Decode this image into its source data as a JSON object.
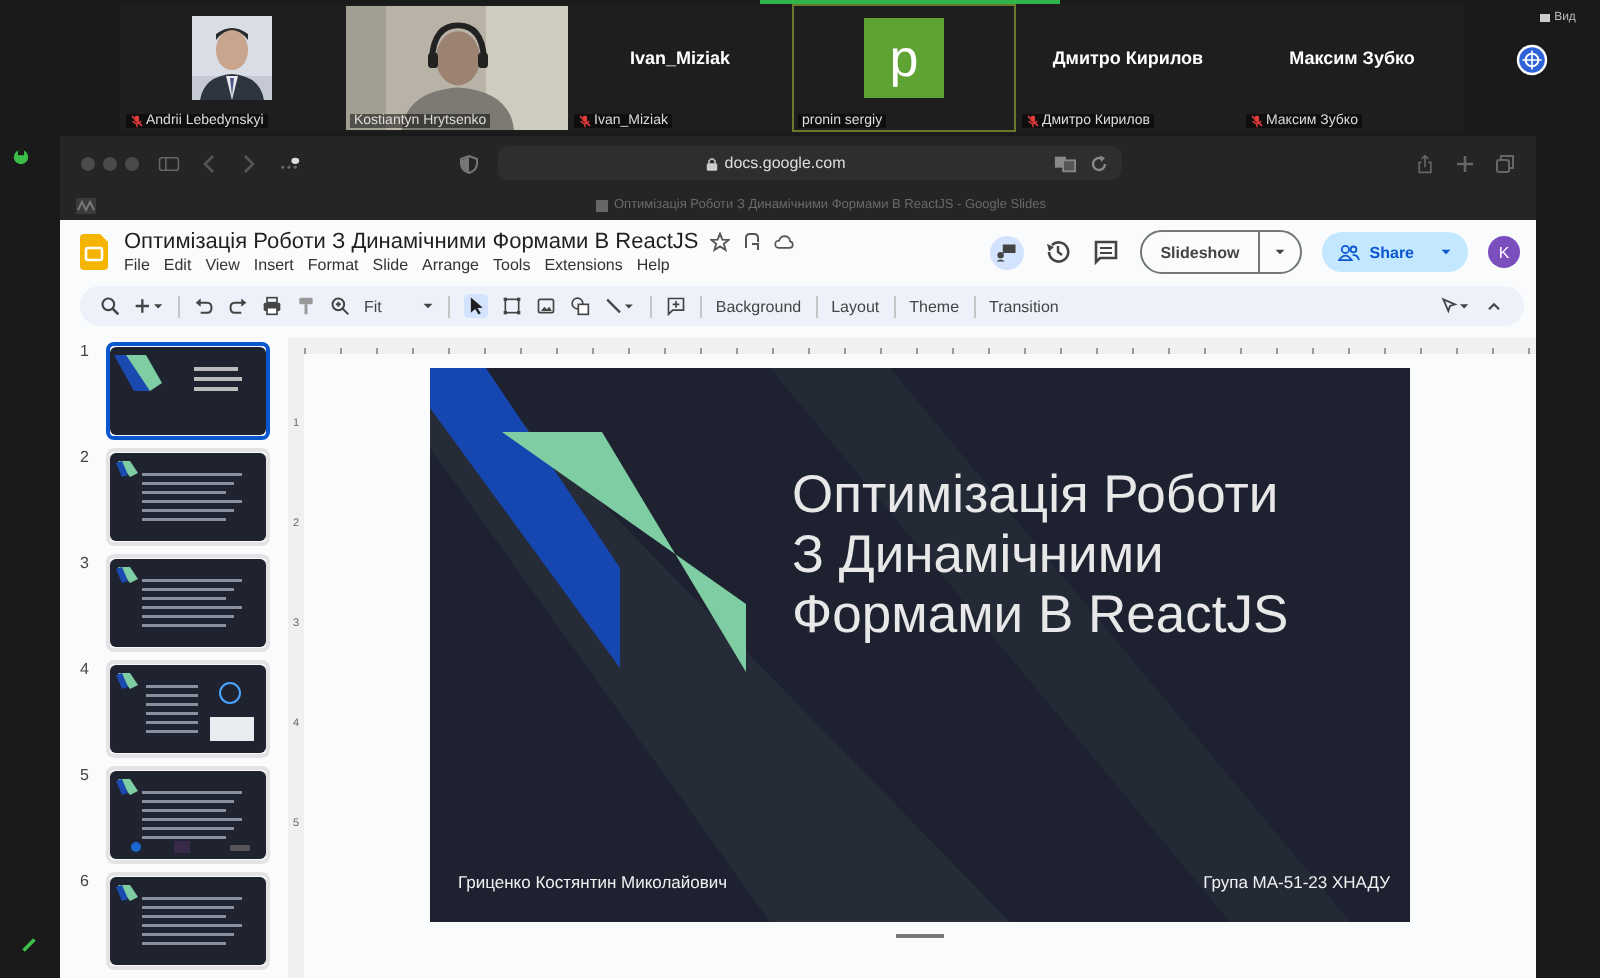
{
  "participants": [
    {
      "label": "Andrii Lebedynskyi",
      "muted": true,
      "speaking": false
    },
    {
      "kind": "video",
      "label": "Kostiantyn Hrytsenko",
      "muted": false,
      "speaking": false
    },
    {
      "kind": "name",
      "display": "Ivan_Miziak",
      "label": "Ivan_Miziak",
      "muted": true,
      "speaking": false
    },
    {
      "kind": "avatar",
      "initial": "p",
      "label": "pronin sergiy",
      "muted": false,
      "speaking": true
    },
    {
      "kind": "name",
      "display": "Дмитро Кирилов",
      "label": "Дмитро Кирилов",
      "muted": true,
      "speaking": false
    },
    {
      "kind": "name",
      "display": "Максим Зубко",
      "label": "Максим Зубко",
      "muted": true,
      "speaking": false
    }
  ],
  "view_button": "Вид",
  "browser": {
    "url": "docs.google.com",
    "tab_title": "Оптимізація Роботи З Динамічними Формами В ReactJS - Google Slides"
  },
  "doc": {
    "title": "Оптимізація Роботи З Динамічними Формами В ReactJS",
    "menu": [
      "File",
      "Edit",
      "View",
      "Insert",
      "Format",
      "Slide",
      "Arrange",
      "Tools",
      "Extensions",
      "Help"
    ],
    "zoom": "Fit",
    "toolbar_buttons": [
      "Background",
      "Layout",
      "Theme",
      "Transition"
    ],
    "slideshow": "Slideshow",
    "share": "Share",
    "avatar": "K"
  },
  "slides": [
    {
      "number": "1",
      "selected": true
    },
    {
      "number": "2",
      "selected": false
    },
    {
      "number": "3",
      "selected": false
    },
    {
      "number": "4",
      "selected": false
    },
    {
      "number": "5",
      "selected": false
    },
    {
      "number": "6",
      "selected": false
    }
  ],
  "vertical_ruler": [
    "1",
    "2",
    "3",
    "4",
    "5"
  ],
  "slide": {
    "title_lines": [
      "Оптимізація Роботи",
      "З Динамічними",
      "Формами В ReactJS"
    ],
    "author": "Гриценко Костянтин Миколайович",
    "group": "Група МА-51-23 ХНАДУ"
  }
}
